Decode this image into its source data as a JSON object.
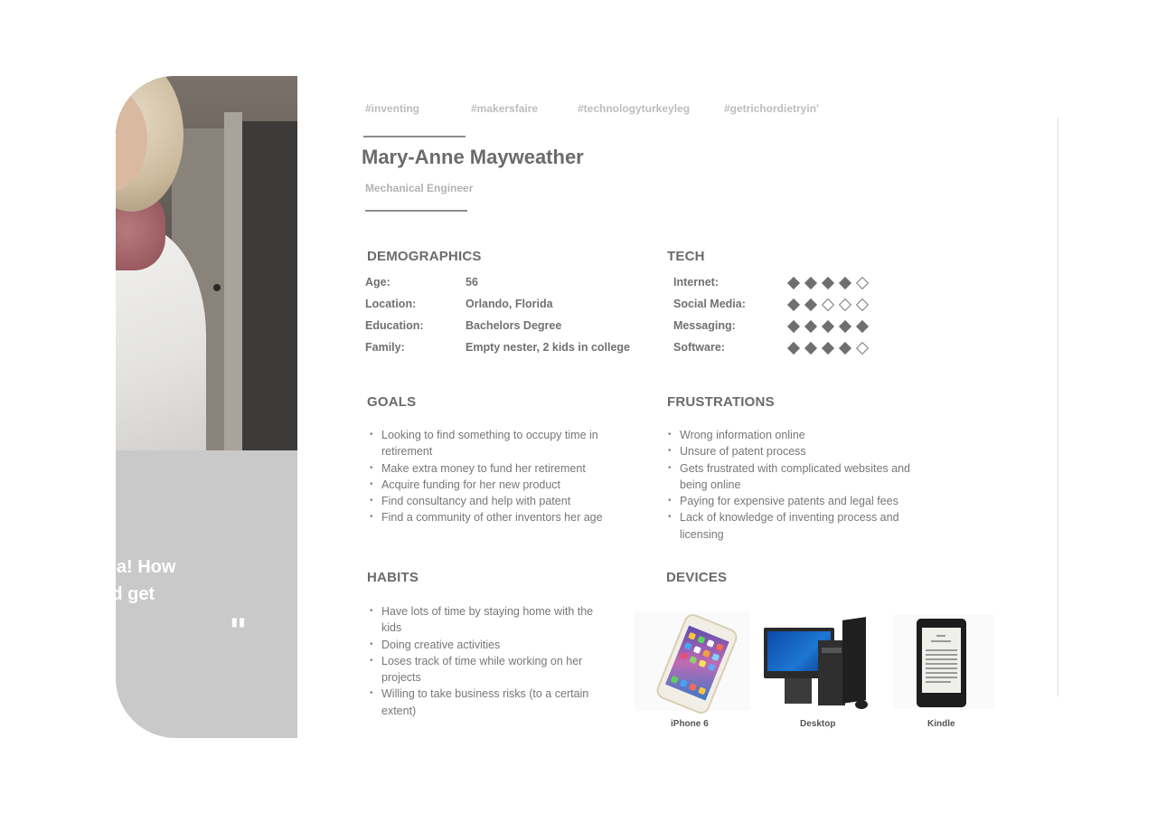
{
  "hashtags": [
    "#inventing",
    "#makersfaire",
    "#technologyturkeyleg",
    "#getrichordietryin'"
  ],
  "persona": {
    "name": "Mary-Anne Mayweather",
    "role": "Mechanical Engineer"
  },
  "quote": {
    "text": "Idea! How\nand get",
    "mark": "\""
  },
  "demographics": {
    "title": "DEMOGRAPHICS",
    "rows": [
      {
        "label": "Age:",
        "value": "56"
      },
      {
        "label": "Location:",
        "value": "Orlando, Florida"
      },
      {
        "label": "Education:",
        "value": "Bachelors Degree"
      },
      {
        "label": "Family:",
        "value": "Empty nester, 2 kids in college"
      }
    ]
  },
  "tech": {
    "title": "TECH",
    "max_rating": 5,
    "rows": [
      {
        "label": "Internet:",
        "rating": 4
      },
      {
        "label": "Social Media:",
        "rating": 2
      },
      {
        "label": "Messaging:",
        "rating": 5
      },
      {
        "label": "Software:",
        "rating": 4
      }
    ]
  },
  "goals": {
    "title": "GOALS",
    "items": [
      "Looking to find something to occupy time in retirement",
      "Make extra money to fund her retirement",
      "Acquire funding for her new product",
      "Find consultancy and help with patent",
      "Find a community of other inventors her age"
    ]
  },
  "frustrations": {
    "title": "FRUSTRATIONS",
    "items": [
      "Wrong information online",
      "Unsure of patent process",
      "Gets frustrated with complicated websites and being online",
      "Paying for expensive patents and legal fees",
      "Lack of knowledge of inventing process and licensing"
    ]
  },
  "habits": {
    "title": "HABITS",
    "items": [
      "Have lots of time by staying home with the kids",
      "Doing creative activities",
      "Loses track of time while working on her projects",
      "Willing to take business risks (to a certain extent)"
    ]
  },
  "devices": {
    "title": "DEVICES",
    "items": [
      {
        "label": "iPhone 6",
        "icon": "smartphone-icon"
      },
      {
        "label": "Desktop",
        "icon": "desktop-computer-icon"
      },
      {
        "label": "Kindle",
        "icon": "ereader-icon"
      }
    ]
  }
}
